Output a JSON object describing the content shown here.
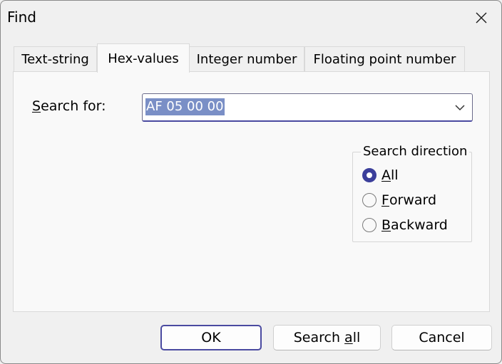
{
  "window": {
    "title": "Find"
  },
  "tabs": [
    {
      "label": "Text-string",
      "active": false
    },
    {
      "label": "Hex-values",
      "active": true
    },
    {
      "label": "Integer number",
      "active": false
    },
    {
      "label": "Floating point number",
      "active": false
    }
  ],
  "search": {
    "label_mnemonic": "S",
    "label_rest": "earch for:",
    "value": "AF 05 00 00",
    "dropdown_icon": "chevron-down-icon"
  },
  "direction": {
    "legend": "Search direction",
    "options": [
      {
        "mnemonic": "A",
        "rest": "ll",
        "checked": true
      },
      {
        "mnemonic": "F",
        "rest": "orward",
        "checked": false
      },
      {
        "mnemonic": "B",
        "rest": "ackward",
        "checked": false
      }
    ]
  },
  "buttons": {
    "ok": "OK",
    "search_all_pre": "Search ",
    "search_all_mnemonic": "a",
    "search_all_post": "ll",
    "cancel": "Cancel"
  },
  "colors": {
    "accent": "#3b3f9b",
    "selection": "#7a8fc6"
  }
}
